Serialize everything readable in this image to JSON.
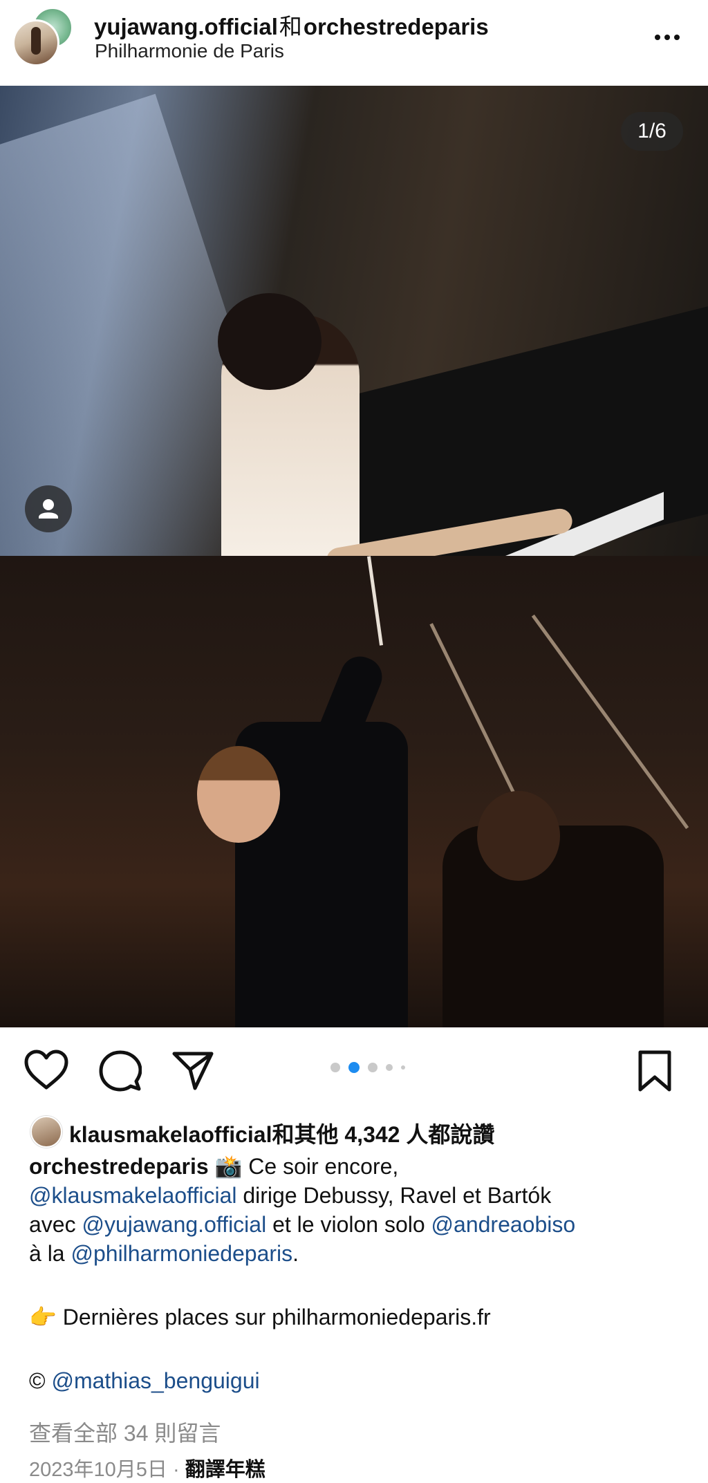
{
  "post_header": {
    "user1": "yujawang.official",
    "joiner": "和",
    "user2": "orchestredeparis",
    "location": "Philharmonie de Paris",
    "more_label": "•••"
  },
  "carousel": {
    "counter": "1/6",
    "current_index": 2,
    "dot_count": 5
  },
  "likes": {
    "text": "klausmakelaofficial和其他 4,342 人都說讚"
  },
  "caption": {
    "username": "orchestredeparis",
    "emoji_camera": "📸",
    "line1_text": " Ce soir encore,",
    "mention_conductor": "@klausmakelaofficial",
    "line2_text": " dirige Debussy, Ravel et Bartók",
    "line3_prefix": "avec ",
    "mention_pianist": "@yujawang.official",
    "line3_middle": " et le violon solo ",
    "mention_violin": "@andreaobiso",
    "line4_prefix": "à la ",
    "mention_hall": "@philharmoniedeparis",
    "line4_suffix": ".",
    "emoji_point": "👉",
    "tickets_text": " Dernières places sur philharmoniedeparis.fr",
    "copyright_symbol": "©",
    "mention_photographer": "@mathias_benguigui"
  },
  "comments_link": "查看全部 34 則留言",
  "date": "2023年10月5日",
  "meta_sep": " · ",
  "translate_label": "翻譯年糕",
  "colors": {
    "mention": "#1c4e8a",
    "muted": "#8a8a8a",
    "active_dot": "#1d8cf0"
  },
  "icons": [
    "heart-icon",
    "comment-icon",
    "share-icon",
    "bookmark-icon",
    "more-icon",
    "person-tag-icon"
  ]
}
